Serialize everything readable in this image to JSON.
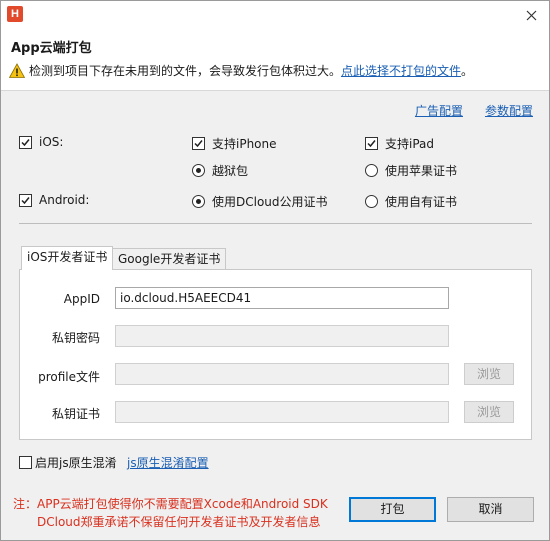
{
  "window": {
    "app_icon_letter": "H"
  },
  "header": {
    "title": "App云端打包",
    "warning_text": "检测到项目下存在未用到的文件，会导致发行包体积过大。",
    "warning_link": "点此选择不打包的文件",
    "warning_suffix": "。"
  },
  "links": {
    "ad_config": "广告配置",
    "param_config": "参数配置"
  },
  "platforms": {
    "ios": {
      "label": "iOS:",
      "checked": true
    },
    "iphone": {
      "label": "支持iPhone",
      "checked": true
    },
    "ipad": {
      "label": "支持iPad",
      "checked": true
    },
    "jailbreak": {
      "label": "越狱包",
      "selected": true
    },
    "apple_cert": {
      "label": "使用苹果证书",
      "selected": false
    },
    "android": {
      "label": "Android:",
      "checked": true
    },
    "dcloud_cert": {
      "label": "使用DCloud公用证书",
      "selected": true
    },
    "own_cert": {
      "label": "使用自有证书",
      "selected": false
    }
  },
  "tabs": [
    {
      "label": "iOS开发者证书",
      "active": true
    },
    {
      "label": "Google开发者证书",
      "active": false
    }
  ],
  "form": {
    "appid_label": "AppID",
    "appid_value": "io.dcloud.H5AEECD41",
    "key_password_label": "私钥密码",
    "profile_label": "profile文件",
    "cert_label": "私钥证书",
    "browse_label": "浏览"
  },
  "obfuscation": {
    "label": "启用js原生混淆",
    "checked": false,
    "config_link": "js原生混淆配置"
  },
  "footer": {
    "note_line1": "注：APP云端打包使得你不需要配置Xcode和Android SDK",
    "note_line2": "DCloud郑重承诺不保留任何开发者证书及开发者信息",
    "pack_button": "打包",
    "cancel_button": "取消"
  },
  "colors": {
    "link": "#1a5fb4",
    "note": "#d9301e",
    "app_icon": "#e14a2b",
    "primary_border": "#0078d7"
  }
}
